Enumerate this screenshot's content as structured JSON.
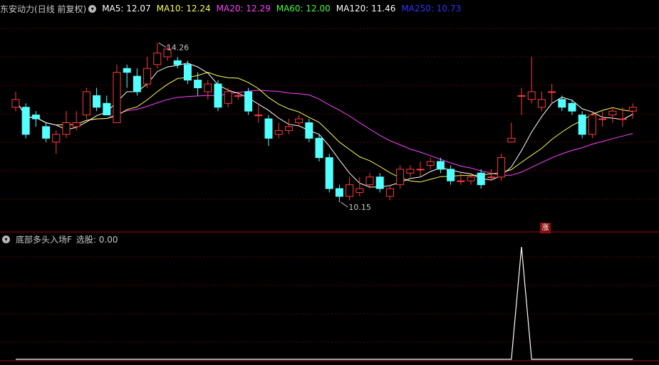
{
  "header": {
    "title": "东安动力",
    "period": "(日线 前复权)",
    "ma": [
      {
        "label": "MA5: 12.07",
        "color": "#ffffff"
      },
      {
        "label": "MA10: 12.24",
        "color": "#ffff55"
      },
      {
        "label": "MA20: 12.29",
        "color": "#ff44ff"
      },
      {
        "label": "MA60: 12.00",
        "color": "#44ff44"
      },
      {
        "label": "MA120: 11.46",
        "color": "#ffffff"
      },
      {
        "label": "MA250: 10.73",
        "color": "#3333ff"
      }
    ]
  },
  "price_high_label": "14.26",
  "price_low_label": "10.15",
  "zhang_badge": "涨",
  "indicator": {
    "name": "底部多头入场F",
    "output": "选股: 0.00"
  },
  "chart_data": {
    "type": "candlestick",
    "ylim": [
      9.4,
      15.0
    ],
    "candles": [
      [
        12.6,
        12.8,
        13.0,
        12.5
      ],
      [
        12.6,
        11.9,
        12.7,
        11.8
      ],
      [
        12.4,
        12.3,
        12.5,
        12.1
      ],
      [
        12.1,
        11.8,
        12.2,
        11.7
      ],
      [
        11.7,
        11.9,
        12.0,
        11.4
      ],
      [
        11.9,
        12.2,
        12.5,
        11.8
      ],
      [
        12.1,
        12.2,
        12.5,
        12.0
      ],
      [
        12.4,
        13.0,
        13.1,
        12.3
      ],
      [
        12.9,
        12.6,
        13.1,
        12.5
      ],
      [
        12.7,
        12.4,
        12.9,
        12.4
      ],
      [
        12.2,
        13.5,
        13.7,
        12.3
      ],
      [
        13.6,
        13.5,
        13.7,
        13.1
      ],
      [
        13.4,
        13.0,
        13.6,
        12.9
      ],
      [
        13.2,
        13.6,
        13.9,
        13.1
      ],
      [
        13.7,
        14.0,
        14.26,
        13.6
      ],
      [
        13.9,
        14.1,
        14.2,
        13.8
      ],
      [
        13.8,
        13.7,
        13.9,
        13.6
      ],
      [
        13.7,
        13.3,
        13.8,
        13.2
      ],
      [
        13.3,
        13.1,
        13.5,
        12.9
      ],
      [
        13.0,
        13.2,
        13.3,
        12.8
      ],
      [
        13.2,
        12.6,
        13.3,
        12.5
      ],
      [
        12.7,
        13.0,
        13.1,
        12.6
      ],
      [
        12.9,
        12.9,
        13.0,
        12.8
      ],
      [
        13.0,
        12.5,
        13.1,
        12.4
      ],
      [
        12.4,
        12.4,
        12.7,
        12.2
      ],
      [
        12.3,
        11.8,
        12.4,
        11.6
      ],
      [
        11.9,
        12.0,
        12.2,
        11.8
      ],
      [
        12.0,
        12.1,
        12.3,
        11.9
      ],
      [
        12.2,
        12.3,
        12.4,
        12.1
      ],
      [
        12.2,
        11.8,
        12.3,
        11.7
      ],
      [
        11.8,
        11.3,
        11.9,
        11.2
      ],
      [
        11.3,
        10.5,
        11.4,
        10.4
      ],
      [
        10.5,
        10.3,
        10.6,
        10.15
      ],
      [
        10.3,
        10.6,
        10.8,
        10.2
      ],
      [
        10.4,
        10.5,
        10.8,
        10.3
      ],
      [
        10.6,
        10.8,
        10.9,
        10.5
      ],
      [
        10.8,
        10.5,
        10.9,
        10.4
      ],
      [
        10.3,
        10.5,
        10.6,
        10.2
      ],
      [
        10.6,
        11.0,
        11.1,
        10.5
      ],
      [
        10.9,
        11.0,
        11.1,
        10.8
      ],
      [
        11.0,
        11.0,
        11.2,
        10.8
      ],
      [
        11.1,
        11.2,
        11.3,
        11.0
      ],
      [
        11.2,
        11.0,
        11.3,
        10.9
      ],
      [
        11.0,
        10.7,
        11.1,
        10.6
      ],
      [
        10.7,
        10.7,
        10.9,
        10.6
      ],
      [
        10.7,
        10.8,
        10.9,
        10.6
      ],
      [
        10.9,
        10.6,
        11.0,
        10.5
      ],
      [
        10.8,
        10.8,
        11.0,
        10.7
      ],
      [
        10.8,
        11.3,
        11.4,
        10.7
      ],
      [
        11.7,
        11.8,
        12.2,
        11.7
      ],
      [
        12.9,
        12.9,
        13.1,
        12.4
      ],
      [
        12.8,
        13.0,
        13.9,
        12.7
      ],
      [
        12.6,
        12.8,
        13.0,
        12.5
      ],
      [
        13.0,
        13.0,
        13.2,
        12.7
      ],
      [
        12.8,
        12.6,
        12.9,
        12.5
      ],
      [
        12.7,
        12.5,
        12.8,
        12.4
      ],
      [
        12.4,
        11.9,
        12.5,
        11.8
      ],
      [
        11.9,
        12.4,
        12.5,
        11.8
      ],
      [
        12.3,
        12.3,
        12.5,
        12.1
      ],
      [
        12.4,
        12.5,
        12.6,
        12.2
      ],
      [
        12.3,
        12.3,
        12.6,
        12.1
      ],
      [
        12.5,
        12.6,
        12.7,
        12.3
      ]
    ],
    "indicator_values": [
      0,
      0,
      0,
      0,
      0,
      0,
      0,
      0,
      0,
      0,
      0,
      0,
      0,
      0,
      0,
      0,
      0,
      0,
      0,
      0,
      0,
      0,
      0,
      0,
      0,
      0,
      0,
      0,
      0,
      0,
      0,
      0,
      0,
      0,
      0,
      0,
      0,
      0,
      0,
      0,
      0,
      0,
      0,
      0,
      0,
      0,
      0,
      0,
      0,
      0,
      1,
      0,
      0,
      0,
      0,
      0,
      0,
      0,
      0,
      0,
      0,
      0
    ]
  }
}
